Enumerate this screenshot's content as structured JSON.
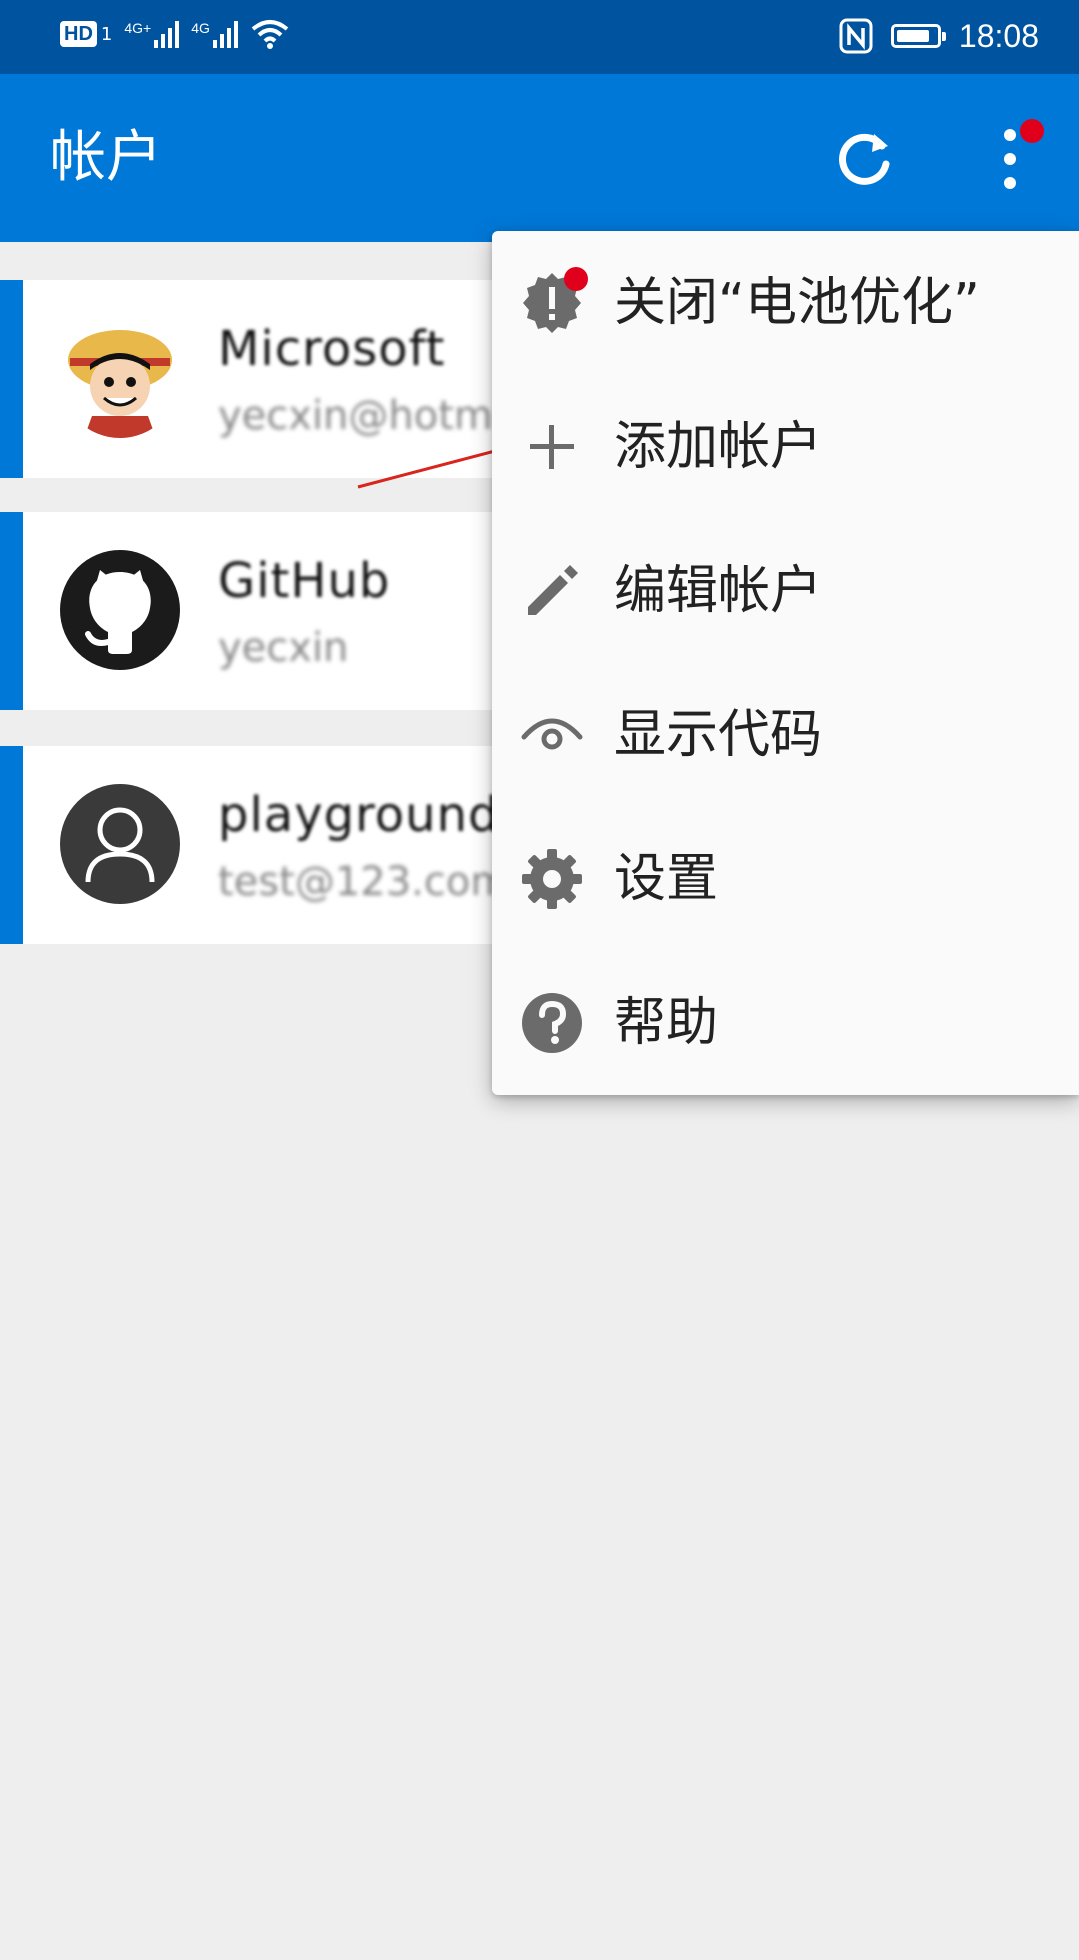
{
  "status_bar": {
    "hd_label": "HD",
    "sim_sub": "1",
    "network1": "4G+",
    "network2": "4G",
    "time": "18:08",
    "battery_level": 0.85,
    "icons": [
      "hd-icon",
      "signal-icon",
      "wifi-icon",
      "nfc-icon",
      "battery-icon"
    ]
  },
  "app_bar": {
    "title": "帐户",
    "refresh_icon": "refresh-icon",
    "more_icon": "more-vert-icon",
    "notification_dot_color": "#e0001b"
  },
  "accounts": [
    {
      "issuer": "Microsoft",
      "account": "yecxin@hotmail",
      "avatar": "anime-avatar"
    },
    {
      "issuer": "GitHub",
      "account": "yecxin",
      "avatar": "github-icon"
    },
    {
      "issuer": "playground",
      "account": "test@123.com",
      "avatar": "person-icon"
    }
  ],
  "menu": {
    "items": [
      {
        "label": "关闭“电池优化”",
        "icon": "alert-badge-icon",
        "has_dot": true
      },
      {
        "label": "添加帐户",
        "icon": "plus-icon"
      },
      {
        "label": "编辑帐户",
        "icon": "pencil-icon"
      },
      {
        "label": "显示代码",
        "icon": "eye-icon"
      },
      {
        "label": "设置",
        "icon": "gear-icon"
      },
      {
        "label": "帮助",
        "icon": "help-icon"
      }
    ]
  },
  "colors": {
    "status_bar": "#00549f",
    "app_bar": "#0078d7",
    "accent": "#0078d7",
    "background": "#eeeeee",
    "menu_bg": "#fafafa",
    "icon_gray": "#6b6b6b",
    "annotation_arrow": "#d9251d"
  }
}
